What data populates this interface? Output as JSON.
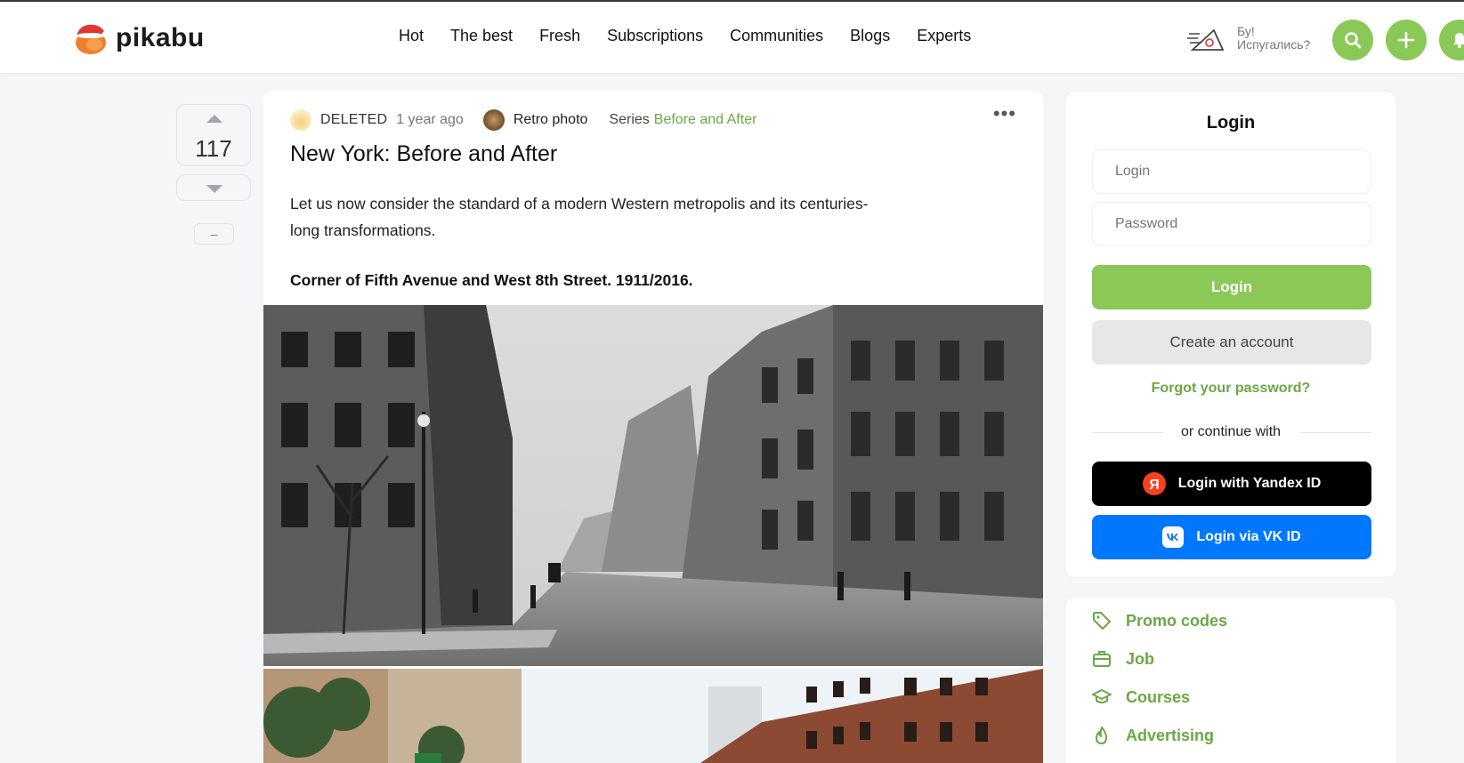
{
  "header": {
    "logo_text": "pikabu",
    "nav": [
      "Hot",
      "The best",
      "Fresh",
      "Subscriptions",
      "Communities",
      "Blogs",
      "Experts"
    ],
    "boo_line1": "Бу!",
    "boo_line2": "Испугались?"
  },
  "vote": {
    "count": "117",
    "minus_label": "–"
  },
  "story": {
    "author": "DELETED",
    "time": "1 year ago",
    "community": "Retro photo",
    "series_label": "Series",
    "series_value": "Before and After",
    "title": "New York: Before and After",
    "body": "Let us now consider the standard of a modern Western metropolis and its centuries-long transformations.",
    "caption": "Corner of Fifth Avenue and West 8th Street. 1911/2016."
  },
  "login": {
    "title": "Login",
    "login_placeholder": "Login",
    "password_placeholder": "Password",
    "login_button": "Login",
    "create_button": "Create an account",
    "forgot": "Forgot your password?",
    "or_text": "or continue with",
    "yandex_button": "Login with Yandex ID",
    "vk_button": "Login via VK ID"
  },
  "sidebar_links": [
    {
      "label": "Promo codes",
      "icon": "tag-icon"
    },
    {
      "label": "Job",
      "icon": "briefcase-icon"
    },
    {
      "label": "Courses",
      "icon": "graduation-cap-icon"
    },
    {
      "label": "Advertising",
      "icon": "fire-icon"
    }
  ],
  "colors": {
    "brand_green": "#8ac858",
    "link_green": "#6aa845",
    "vk_blue": "#0077ff",
    "yandex_red": "#fc3f1d"
  }
}
